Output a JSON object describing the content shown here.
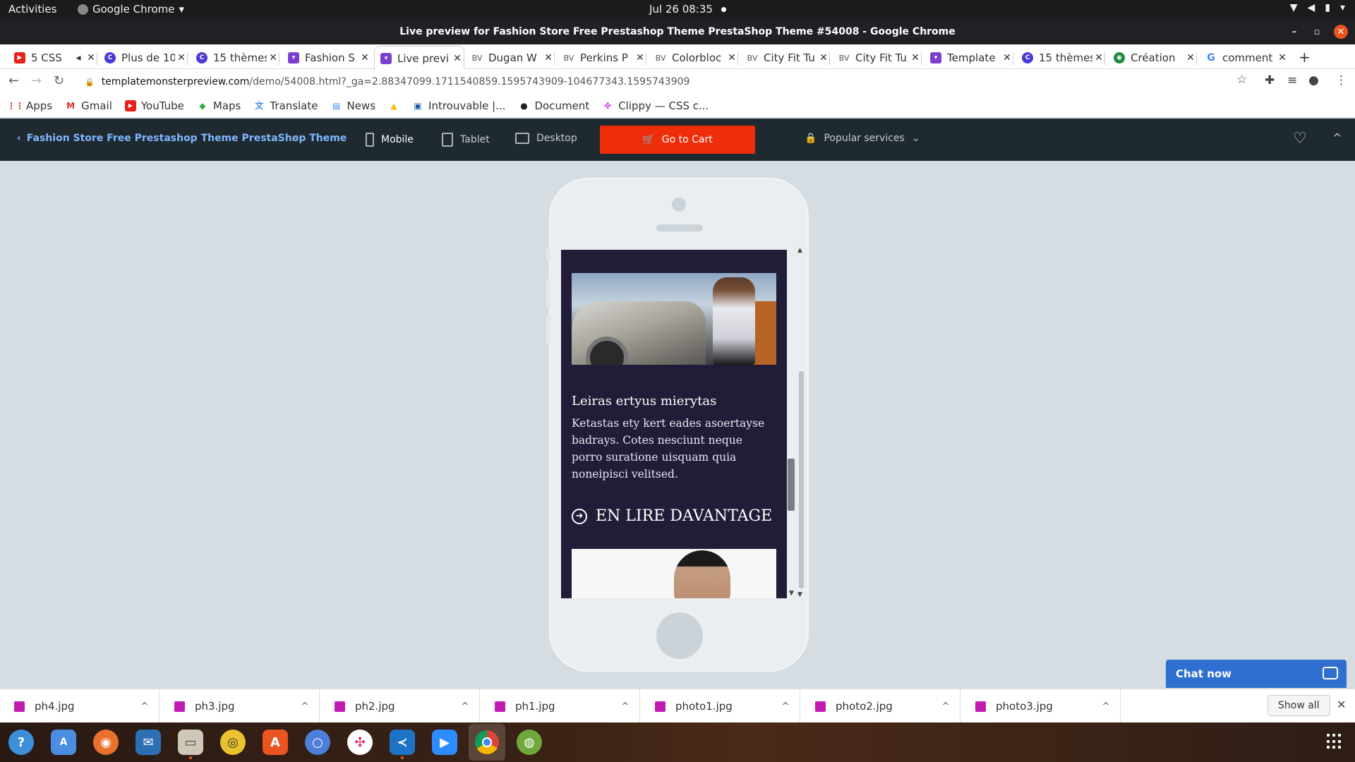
{
  "system": {
    "activities": "Activities",
    "app_name": "Google Chrome",
    "clock": "Jul 26  08:35"
  },
  "window": {
    "title": "Live preview for Fashion Store Free Prestashop Theme PrestaShop Theme #54008 - Google Chrome"
  },
  "tabs": [
    {
      "label": "5 CSS",
      "icon": "youtube-icon"
    },
    {
      "label": "Plus de 10",
      "icon": "canva-icon"
    },
    {
      "label": "15 thèmes",
      "icon": "canva-icon"
    },
    {
      "label": "Fashion S",
      "icon": "templatemonster-icon"
    },
    {
      "label": "Live previ",
      "icon": "templatemonster-icon"
    },
    {
      "label": "Dugan W",
      "icon": "bv-icon"
    },
    {
      "label": "Perkins P",
      "icon": "bv-icon"
    },
    {
      "label": "Colorbloc",
      "icon": "bv-icon"
    },
    {
      "label": "City Fit Tu",
      "icon": "bv-icon"
    },
    {
      "label": "City Fit Tu",
      "icon": "bv-icon"
    },
    {
      "label": "Template",
      "icon": "templatemonster-icon"
    },
    {
      "label": "15 thèmes",
      "icon": "canva-icon"
    },
    {
      "label": "Création",
      "icon": "globe-icon"
    },
    {
      "label": "comment",
      "icon": "google-icon"
    }
  ],
  "tab_bv_prefix": "BV",
  "address": {
    "host": "templatemonsterpreview.com",
    "path": "/demo/54008.html?_ga=2.88347099.1711540859.1595743909-104677343.1595743909"
  },
  "bookmarks": [
    {
      "label": "Apps"
    },
    {
      "label": "Gmail"
    },
    {
      "label": "YouTube"
    },
    {
      "label": "Maps"
    },
    {
      "label": "Translate"
    },
    {
      "label": "News"
    },
    {
      "label": ""
    },
    {
      "label": "Introuvable |..."
    },
    {
      "label": "Document"
    },
    {
      "label": "Clippy — CSS c..."
    }
  ],
  "toolbar": {
    "back_title": "Fashion Store Free Prestashop Theme PrestaShop Theme",
    "device_mobile": "Mobile",
    "device_tablet": "Tablet",
    "device_desktop": "Desktop",
    "cart_label": "Go to Cart",
    "popular_label": "Popular services"
  },
  "preview": {
    "heading": "Leiras ertyus mierytas",
    "body": "Ketastas ety kert eades asoertayse badrays. Cotes nesciunt neque porro suratione uisquam quia noneipisci velitsed.",
    "read_more": "EN LIRE DAVANTAGE",
    "inner_scroll_position": 0.55,
    "outer_scroll_position": 0.45
  },
  "chat": {
    "label": "Chat now"
  },
  "downloads": [
    {
      "name": "ph4.jpg"
    },
    {
      "name": "ph3.jpg"
    },
    {
      "name": "ph2.jpg"
    },
    {
      "name": "ph1.jpg"
    },
    {
      "name": "photo1.jpg"
    },
    {
      "name": "photo2.jpg"
    },
    {
      "name": "photo3.jpg"
    }
  ],
  "download_show_all": "Show all",
  "colors": {
    "accent_cart": "#ee2e0b",
    "toolbar_bg": "#1e2930",
    "preview_bg": "#211c38",
    "chat_bg": "#2f6fcf"
  }
}
